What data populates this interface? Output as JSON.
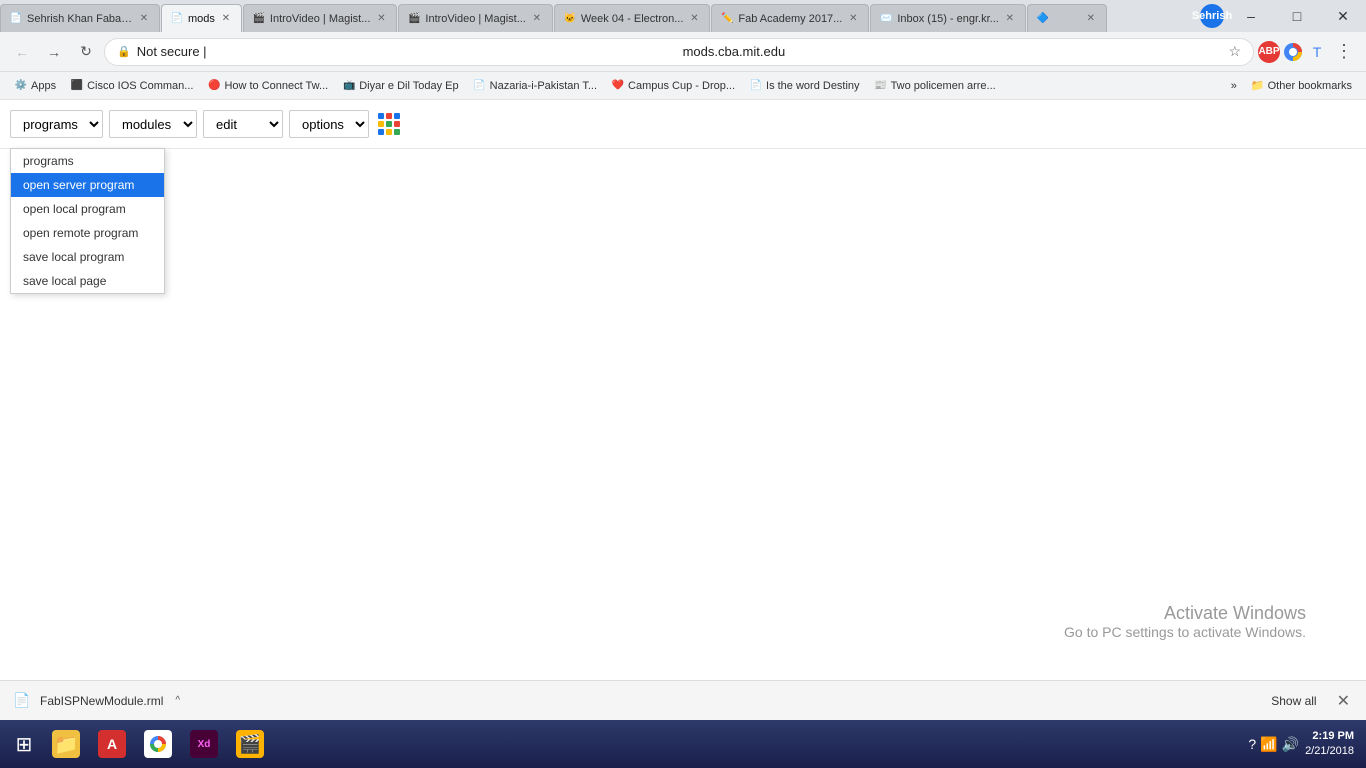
{
  "window": {
    "title": "mods",
    "user": "Sehrish"
  },
  "tabs": [
    {
      "id": "tab1",
      "label": "Sehrish Khan Fabac...",
      "favicon": "📄",
      "active": false,
      "closable": true
    },
    {
      "id": "tab2",
      "label": "mods",
      "favicon": "📄",
      "active": true,
      "closable": true
    },
    {
      "id": "tab3",
      "label": "IntroVideo | Magist...",
      "favicon": "🎬",
      "active": false,
      "closable": true
    },
    {
      "id": "tab4",
      "label": "IntroVideo | Magist...",
      "favicon": "🎬",
      "active": false,
      "closable": true
    },
    {
      "id": "tab5",
      "label": "Week 04 - Electron...",
      "favicon": "🐱",
      "active": false,
      "closable": true
    },
    {
      "id": "tab6",
      "label": "Fab Academy 2017...",
      "favicon": "✏️",
      "active": false,
      "closable": true
    },
    {
      "id": "tab7",
      "label": "Inbox (15) - engr.kr...",
      "favicon": "✉️",
      "active": false,
      "closable": true
    },
    {
      "id": "tab8",
      "label": "",
      "favicon": "🔷",
      "active": false,
      "closable": true
    }
  ],
  "navbar": {
    "url": "mods.cba.mit.edu",
    "protocol": "Not secure",
    "lock_label": "🔒"
  },
  "bookmarks": [
    {
      "label": "Apps",
      "favicon": "⚙️"
    },
    {
      "label": "Cisco IOS Comman...",
      "favicon": "⬛"
    },
    {
      "label": "How to Connect Tw...",
      "favicon": "🔴"
    },
    {
      "label": "Diyar e Dil Today Ep",
      "favicon": "📺"
    },
    {
      "label": "Nazaria-i-Pakistan T...",
      "favicon": "📄"
    },
    {
      "label": "Campus Cup - Drop...",
      "favicon": "❤️"
    },
    {
      "label": "Is the word Destiny",
      "favicon": "📄"
    },
    {
      "label": "Two policemen arre...",
      "favicon": "📰"
    }
  ],
  "toolbar": {
    "programs_label": "programs",
    "modules_label": "modules",
    "edit_label": "edit",
    "options_label": "options"
  },
  "programs_menu": {
    "items": [
      {
        "label": "programs",
        "highlighted": false
      },
      {
        "label": "open server program",
        "highlighted": true
      },
      {
        "label": "open local program",
        "highlighted": false
      },
      {
        "label": "open remote program",
        "highlighted": false
      },
      {
        "label": "save local program",
        "highlighted": false
      },
      {
        "label": "save local page",
        "highlighted": false
      }
    ]
  },
  "grid_colors": [
    "#1a73e8",
    "#ea4335",
    "#1a73e8",
    "#fbbc04",
    "#34a853",
    "#ea4335",
    "#1a73e8",
    "#fbbc04",
    "#34a853"
  ],
  "watermark": {
    "line1": "Activate Windows",
    "line2": "Go to PC settings to activate Windows."
  },
  "download": {
    "filename": "FabISPNewModule.rml",
    "show_all": "Show all",
    "chevron": "^"
  },
  "taskbar": {
    "time": "2:19 PM",
    "date": "2/21/2018",
    "apps": [
      {
        "name": "start",
        "icon": "⊞",
        "color": "#fff"
      },
      {
        "name": "file-explorer",
        "icon": "📁",
        "bg": "#f0c040"
      },
      {
        "name": "acrobat",
        "icon": "Ⓐ",
        "bg": "#d32f2f"
      },
      {
        "name": "chrome",
        "icon": "◎",
        "bg": "#fff"
      },
      {
        "name": "adobe-xd",
        "icon": "Xd",
        "bg": "#470137"
      },
      {
        "name": "app5",
        "icon": "🎬",
        "bg": "#ffb300"
      }
    ]
  }
}
